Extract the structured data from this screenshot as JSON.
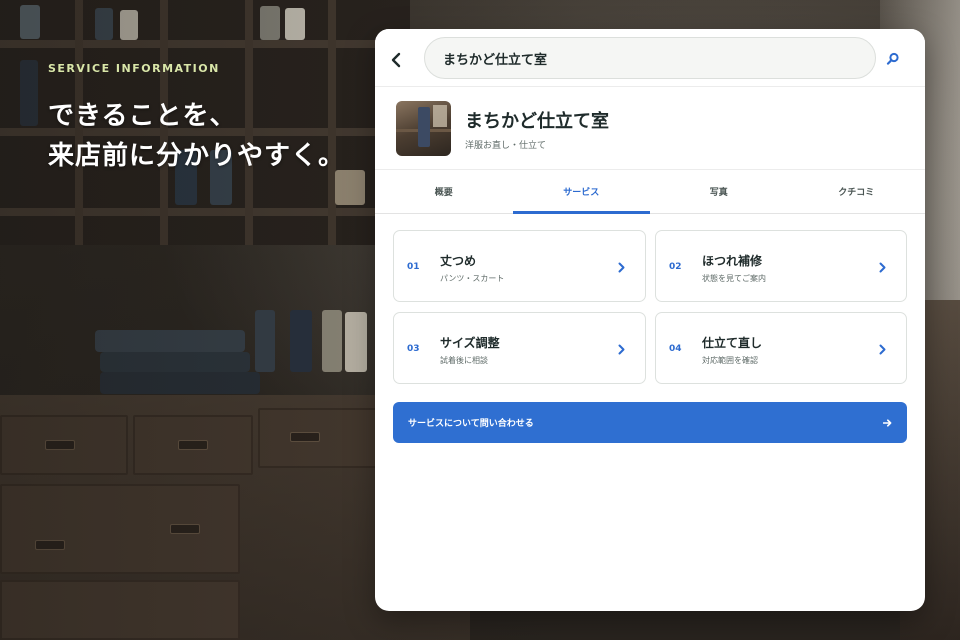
{
  "hero": {
    "eyebrow": "SERVICE INFORMATION",
    "headline_line1": "できることを、",
    "headline_line2": "来店前に分かりやすく。"
  },
  "topbar": {
    "back_icon": "chevron-left-icon",
    "search_value": "まちかど仕立て室",
    "search_icon": "search-icon"
  },
  "shop": {
    "name": "まちかど仕立て室",
    "category": "洋服お直し・仕立て"
  },
  "tabs": [
    {
      "label": "概要",
      "active": false
    },
    {
      "label": "サービス",
      "active": true
    },
    {
      "label": "写真",
      "active": false
    },
    {
      "label": "クチコミ",
      "active": false
    }
  ],
  "services": [
    {
      "number": "01",
      "title": "丈つめ",
      "subtitle": "パンツ・スカート"
    },
    {
      "number": "02",
      "title": "ほつれ補修",
      "subtitle": "状態を見てご案内"
    },
    {
      "number": "03",
      "title": "サイズ調整",
      "subtitle": "試着後に相談"
    },
    {
      "number": "04",
      "title": "仕立て直し",
      "subtitle": "対応範囲を確認"
    }
  ],
  "cta": {
    "label": "サービスについて問い合わせる",
    "icon": "arrow-right-icon"
  },
  "colors": {
    "accent": "#2f6fd1",
    "eyebrow": "#d9e6a8",
    "text_dark": "#1f2b2b"
  }
}
